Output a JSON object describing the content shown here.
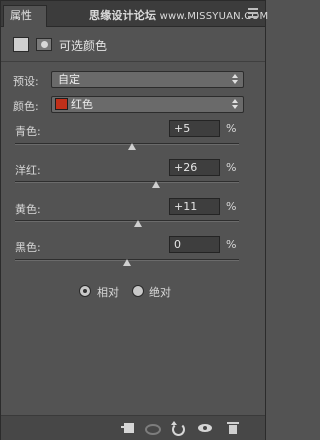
{
  "tabs": {
    "active_label": "属性"
  },
  "watermark": {
    "cn": "思缘设计论坛",
    "en": "www.MISSYUAN.COM"
  },
  "header": {
    "title": "可选颜色"
  },
  "preset": {
    "label": "预设:",
    "value": "自定"
  },
  "colors": {
    "label": "颜色:",
    "value": "红色",
    "swatch_color": "#c0301a"
  },
  "sliders": [
    {
      "label": "青色:",
      "value": "+5",
      "unit": "%",
      "level_pct": 52.2
    },
    {
      "label": "洋红:",
      "value": "+26",
      "unit": "%",
      "level_pct": 63.1
    },
    {
      "label": "黄色:",
      "value": "+11",
      "unit": "%",
      "level_pct": 55.0
    },
    {
      "label": "黑色:",
      "value": "0",
      "unit": "%",
      "level_pct": 50.0
    }
  ],
  "method": {
    "relative_label": "相对",
    "absolute_label": "绝对",
    "selected": "relative"
  },
  "bottom_icons": [
    "clip-to-layer-icon",
    "view-previous-icon",
    "reset-icon",
    "visibility-eye-icon",
    "trash-icon"
  ]
}
